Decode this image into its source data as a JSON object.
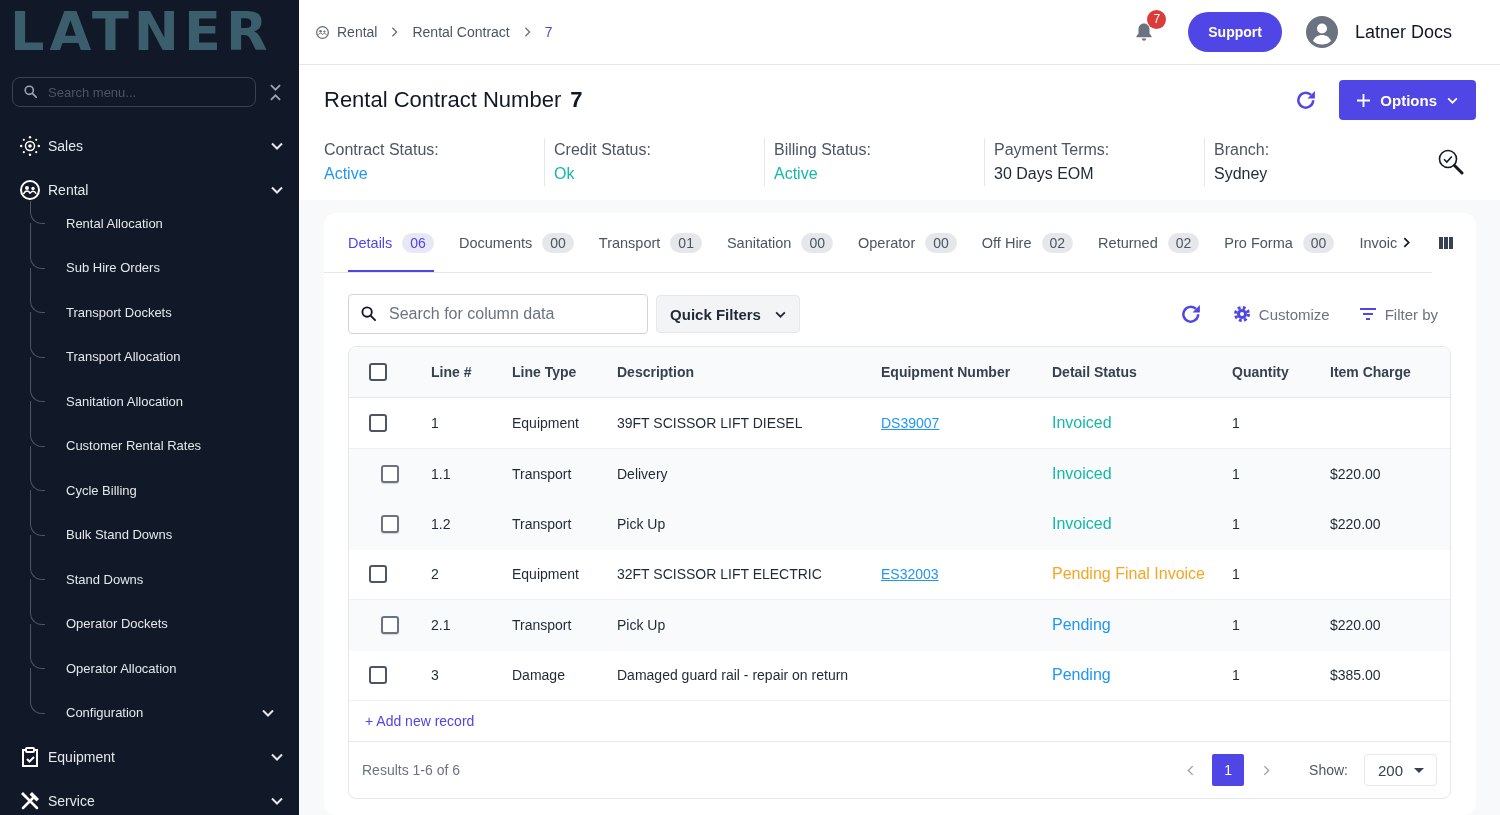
{
  "sidebar": {
    "logo": "LATNER",
    "search": {
      "placeholder": "Search menu..."
    },
    "items": [
      {
        "label": "Sales",
        "expanded": false
      },
      {
        "label": "Rental",
        "expanded": true,
        "children": [
          {
            "label": "Rental Allocation"
          },
          {
            "label": "Sub Hire Orders"
          },
          {
            "label": "Transport Dockets"
          },
          {
            "label": "Transport Allocation"
          },
          {
            "label": "Sanitation Allocation"
          },
          {
            "label": "Customer Rental Rates"
          },
          {
            "label": "Cycle Billing"
          },
          {
            "label": "Bulk Stand Downs"
          },
          {
            "label": "Stand Downs"
          },
          {
            "label": "Operator Dockets"
          },
          {
            "label": "Operator Allocation"
          },
          {
            "label": "Configuration",
            "expanded": false
          }
        ]
      },
      {
        "label": "Equipment",
        "expanded": false
      },
      {
        "label": "Service",
        "expanded": false
      }
    ]
  },
  "top_bar": {
    "breadcrumbs": [
      {
        "label": "Rental",
        "current": false
      },
      {
        "label": "Rental Contract",
        "current": false
      },
      {
        "label": "7",
        "current": true
      }
    ],
    "notifications": "7",
    "support_button": "Support",
    "user_name": "Latner Docs"
  },
  "header": {
    "title": "Rental Contract Number **7**",
    "options_button": "Options",
    "fields": [
      {
        "label": "Contract Status:",
        "value": "Active",
        "color": "#2196f3"
      },
      {
        "label": "Credit Status:",
        "value": "Ok",
        "color": "#14b8a6"
      },
      {
        "label": "Billing Status:",
        "value": "Active",
        "color": "#14b8a6"
      },
      {
        "label": "Payment Terms:",
        "value": "30 Days EOM",
        "color": "#1f2937"
      },
      {
        "label": "Branch:",
        "value": "Sydney",
        "color": "#1f2937"
      }
    ]
  },
  "tabs": [
    {
      "label": "Details",
      "count": "06",
      "selected": true
    },
    {
      "label": "Documents",
      "count": "00",
      "selected": false
    },
    {
      "label": "Transport",
      "count": "01",
      "selected": false
    },
    {
      "label": "Sanitation",
      "count": "00",
      "selected": false
    },
    {
      "label": "Operator",
      "count": "00",
      "selected": false
    },
    {
      "label": "Off Hire",
      "count": "02",
      "selected": false
    },
    {
      "label": "Returned",
      "count": "02",
      "selected": false
    },
    {
      "label": "Pro Forma",
      "count": "00",
      "selected": false
    },
    {
      "label": "Invoic",
      "selected": false
    }
  ],
  "toolbar": {
    "search": {
      "placeholder": "Search for column data"
    },
    "quick_filters": "Quick Filters",
    "customize": "Customize",
    "filter_by": "Filter by"
  },
  "table": {
    "select_all": {
      "checked": false
    },
    "columns": [
      "Line #",
      "Line Type",
      "Description",
      "Equipment Number",
      "Detail Status",
      "Quantity",
      "Item Charge"
    ],
    "rows": [
      {
        "line": "1",
        "line_type": "Equipment",
        "description": "39FT SCISSOR LIFT DIESEL",
        "equipment_number": "DS39007",
        "detail_status": {
          "text": "Invoiced",
          "color": "#14b8a6"
        },
        "quantity": "1",
        "checked": false,
        "children": [
          {
            "line": "1.1",
            "line_type": "Transport",
            "description": "Delivery",
            "detail_status": {
              "text": "Invoiced",
              "color": "#14b8a6"
            },
            "quantity": "1",
            "item_charge": "$220.00",
            "checked": false
          },
          {
            "line": "1.2",
            "line_type": "Transport",
            "description": "Pick Up",
            "detail_status": {
              "text": "Invoiced",
              "color": "#14b8a6"
            },
            "quantity": "1",
            "item_charge": "$220.00",
            "checked": false
          }
        ]
      },
      {
        "line": "2",
        "line_type": "Equipment",
        "description": "32FT SCISSOR LIFT ELECTRIC",
        "equipment_number": "ES32003",
        "detail_status": {
          "text": "Pending Final Invoice",
          "color": "#f5a623"
        },
        "quantity": "1",
        "checked": false,
        "children": [
          {
            "line": "2.1",
            "line_type": "Transport",
            "description": "Pick Up",
            "detail_status": {
              "text": "Pending",
              "color": "#2196f3"
            },
            "quantity": "1",
            "item_charge": "$220.00",
            "checked": false
          }
        ]
      },
      {
        "line": "3",
        "line_type": "Damage",
        "description": "Damaged guard rail - repair on return",
        "detail_status": {
          "text": "Pending",
          "color": "#2196f3"
        },
        "quantity": "1",
        "item_charge": "$385.00",
        "checked": false
      }
    ],
    "add_record": "+ Add new record"
  },
  "footer": {
    "results": "Results 1-6 of 6",
    "pages": [
      {
        "label": "1",
        "selected": true
      }
    ],
    "show_label": "Show:",
    "page_size": "200"
  }
}
